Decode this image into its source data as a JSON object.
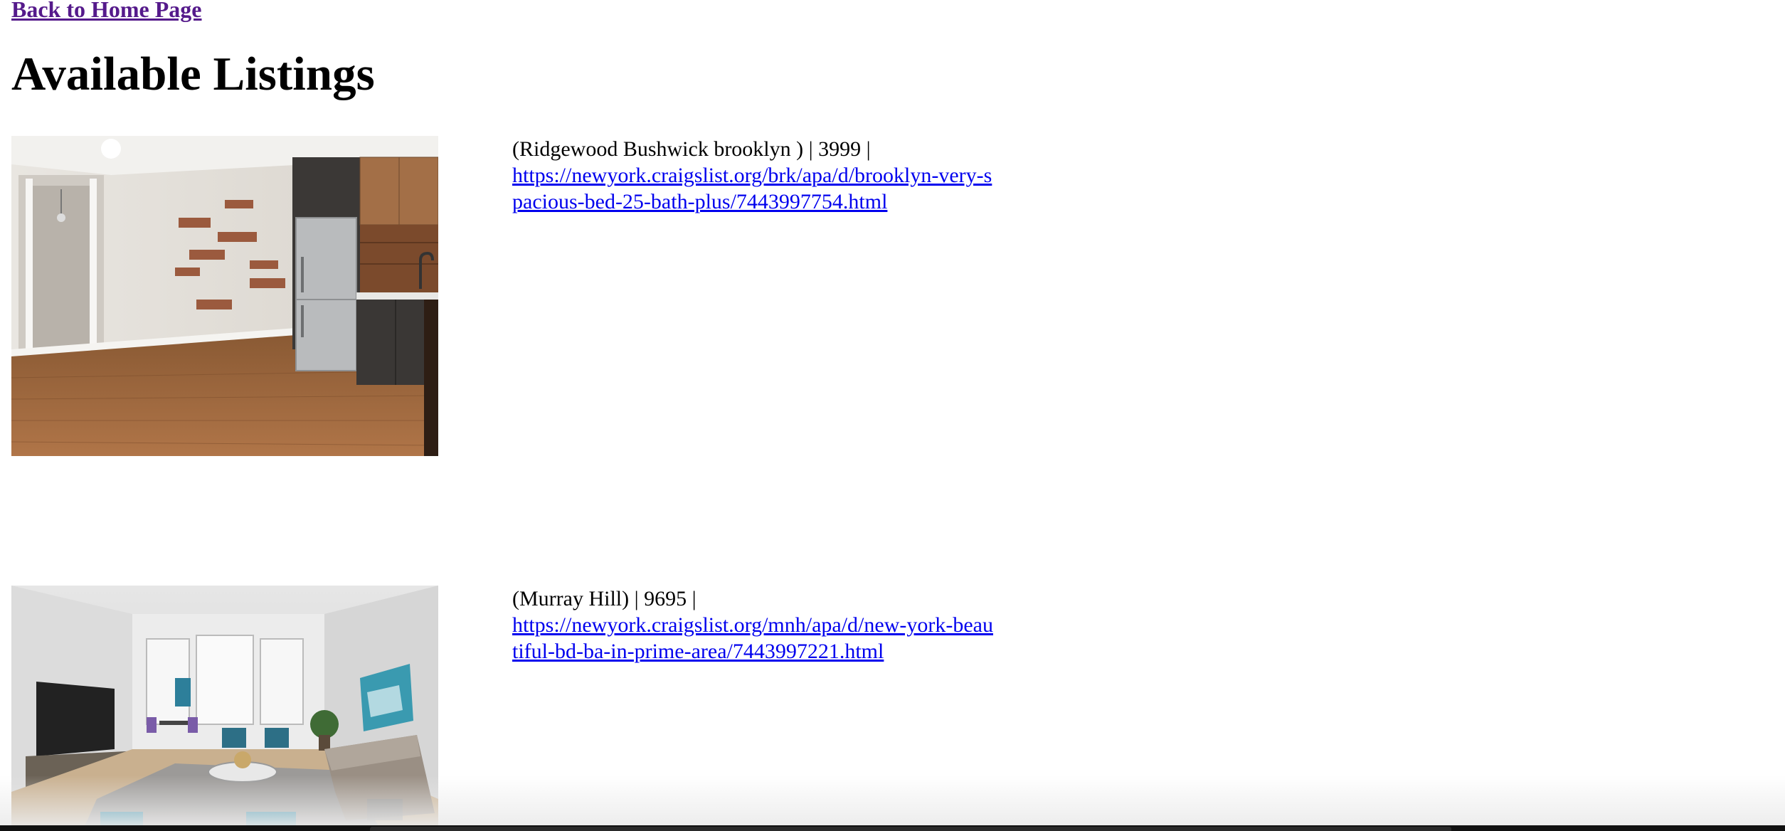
{
  "nav": {
    "back_label": "Back to Home Page"
  },
  "page": {
    "title": "Available Listings"
  },
  "listings": [
    {
      "summary": "(Ridgewood Bushwick brooklyn ) | 3999 |",
      "url": "https://newyork.craigslist.org/brk/apa/d/brooklyn-very-spacious-bed-25-bath-plus/7443997754.html"
    },
    {
      "summary": "(Murray Hill) | 9695 |",
      "url": "https://newyork.craigslist.org/mnh/apa/d/new-york-beautiful-bd-ba-in-prime-area/7443997221.html"
    }
  ],
  "colors": {
    "visited_link": "#551a8b",
    "link": "#0000ee"
  }
}
